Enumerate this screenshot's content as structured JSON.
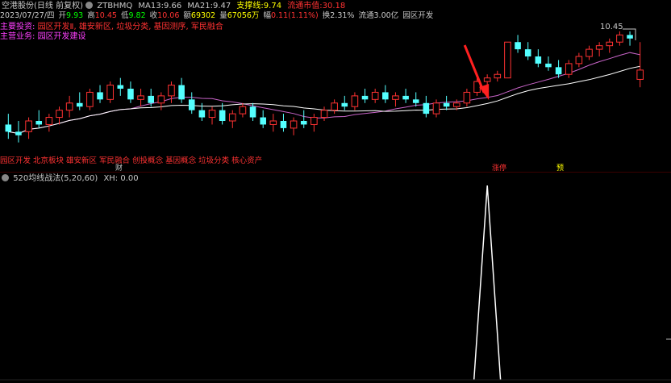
{
  "header": {
    "stock_title": "空港股份(日线 前复权)",
    "gear_icon": "gear-icon",
    "indicator_name": "ZTBHMQ",
    "ma13_label": "MA13:",
    "ma13_value": "9.66",
    "ma21_label": "MA21:",
    "ma21_value": "9.47",
    "support_label": "支撑线:",
    "support_value": "9.74",
    "float_cap_label": "流通市值:",
    "float_cap_value": "30.18"
  },
  "quote": {
    "date": "2023/07/27/四",
    "open_label": "开",
    "open": "9.93",
    "high_label": "高",
    "high": "10.45",
    "low_label": "低",
    "low": "9.82",
    "close_label": "收",
    "close": "10.06",
    "volume_label": "量",
    "volume": "67056万",
    "amount_label": "额",
    "amount": "69302",
    "change_label": "幅",
    "change": "0.11(1.11%)",
    "turnover_label": "换",
    "turnover": "2.31%",
    "float_label": "流通",
    "float": "3.00亿",
    "concept": "园区开发"
  },
  "business": {
    "main_label": "主要投资:",
    "main_text": "园区开发Ⅱ, 雄安新区, 垃圾分类, 基因测序, 军民融合",
    "operate_label": "主营业务:",
    "operate_text": "园区开发建设"
  },
  "concepts_bar": {
    "text": "园区开发 北京板块 雄安新区 军民融合 创投概念 基因概念 垃圾分类 核心资产"
  },
  "chart_labels": {
    "price_high_label": "10.45",
    "date_marker": "财",
    "limit_up_tag": "涨停",
    "forecast_tag": "预"
  },
  "indicator": {
    "title": "520均线战法(5,20,60)",
    "xh_label": "XH:",
    "xh_value": "0.00"
  },
  "colors": {
    "up": "#ff3232",
    "down": "#54ffff",
    "ma_white": "#ffffff",
    "ma_purple": "#c864c8",
    "annotation": "#ff2020",
    "indicator_line": "#ffffff",
    "label_yellow": "#ffff00",
    "label_purple": "#ff40ff"
  },
  "chart_data": {
    "type": "candlestick",
    "title": "空港股份(日线 前复权)",
    "x_range": [
      "",
      "2023/07/27"
    ],
    "y_axis": {
      "top_label": "10.45"
    },
    "candles": [
      {
        "o": 9.3,
        "h": 9.45,
        "l": 9.1,
        "c": 9.2
      },
      {
        "o": 9.2,
        "h": 9.35,
        "l": 9.05,
        "c": 9.15
      },
      {
        "o": 9.2,
        "h": 9.4,
        "l": 9.1,
        "c": 9.35
      },
      {
        "o": 9.35,
        "h": 9.5,
        "l": 9.25,
        "c": 9.3
      },
      {
        "o": 9.3,
        "h": 9.45,
        "l": 9.2,
        "c": 9.4
      },
      {
        "o": 9.4,
        "h": 9.55,
        "l": 9.3,
        "c": 9.5
      },
      {
        "o": 9.5,
        "h": 9.7,
        "l": 9.4,
        "c": 9.6
      },
      {
        "o": 9.6,
        "h": 9.75,
        "l": 9.5,
        "c": 9.55
      },
      {
        "o": 9.55,
        "h": 9.8,
        "l": 9.5,
        "c": 9.75
      },
      {
        "o": 9.75,
        "h": 9.85,
        "l": 9.6,
        "c": 9.65
      },
      {
        "o": 9.65,
        "h": 9.9,
        "l": 9.6,
        "c": 9.85
      },
      {
        "o": 9.85,
        "h": 9.95,
        "l": 9.7,
        "c": 9.8
      },
      {
        "o": 9.8,
        "h": 9.9,
        "l": 9.6,
        "c": 9.65
      },
      {
        "o": 9.65,
        "h": 9.8,
        "l": 9.55,
        "c": 9.7
      },
      {
        "o": 9.7,
        "h": 9.8,
        "l": 9.55,
        "c": 9.6
      },
      {
        "o": 9.6,
        "h": 9.75,
        "l": 9.5,
        "c": 9.7
      },
      {
        "o": 9.7,
        "h": 9.9,
        "l": 9.6,
        "c": 9.85
      },
      {
        "o": 9.85,
        "h": 9.95,
        "l": 9.6,
        "c": 9.65
      },
      {
        "o": 9.65,
        "h": 9.75,
        "l": 9.45,
        "c": 9.5
      },
      {
        "o": 9.5,
        "h": 9.6,
        "l": 9.35,
        "c": 9.4
      },
      {
        "o": 9.4,
        "h": 9.55,
        "l": 9.3,
        "c": 9.5
      },
      {
        "o": 9.5,
        "h": 9.6,
        "l": 9.3,
        "c": 9.35
      },
      {
        "o": 9.35,
        "h": 9.5,
        "l": 9.25,
        "c": 9.45
      },
      {
        "o": 9.45,
        "h": 9.6,
        "l": 9.4,
        "c": 9.55
      },
      {
        "o": 9.55,
        "h": 9.6,
        "l": 9.35,
        "c": 9.4
      },
      {
        "o": 9.4,
        "h": 9.5,
        "l": 9.25,
        "c": 9.3
      },
      {
        "o": 9.3,
        "h": 9.45,
        "l": 9.2,
        "c": 9.35
      },
      {
        "o": 9.35,
        "h": 9.45,
        "l": 9.2,
        "c": 9.25
      },
      {
        "o": 9.25,
        "h": 9.4,
        "l": 9.15,
        "c": 9.35
      },
      {
        "o": 9.35,
        "h": 9.5,
        "l": 9.25,
        "c": 9.3
      },
      {
        "o": 9.3,
        "h": 9.45,
        "l": 9.2,
        "c": 9.4
      },
      {
        "o": 9.4,
        "h": 9.55,
        "l": 9.35,
        "c": 9.5
      },
      {
        "o": 9.5,
        "h": 9.65,
        "l": 9.45,
        "c": 9.6
      },
      {
        "o": 9.6,
        "h": 9.7,
        "l": 9.5,
        "c": 9.55
      },
      {
        "o": 9.55,
        "h": 9.75,
        "l": 9.5,
        "c": 9.7
      },
      {
        "o": 9.7,
        "h": 9.8,
        "l": 9.6,
        "c": 9.65
      },
      {
        "o": 9.65,
        "h": 9.8,
        "l": 9.6,
        "c": 9.75
      },
      {
        "o": 9.75,
        "h": 9.85,
        "l": 9.6,
        "c": 9.65
      },
      {
        "o": 9.65,
        "h": 9.75,
        "l": 9.55,
        "c": 9.7
      },
      {
        "o": 9.7,
        "h": 9.8,
        "l": 9.6,
        "c": 9.65
      },
      {
        "o": 9.65,
        "h": 9.75,
        "l": 9.55,
        "c": 9.6
      },
      {
        "o": 9.6,
        "h": 9.7,
        "l": 9.4,
        "c": 9.45
      },
      {
        "o": 9.45,
        "h": 9.65,
        "l": 9.4,
        "c": 9.6
      },
      {
        "o": 9.6,
        "h": 9.7,
        "l": 9.5,
        "c": 9.55
      },
      {
        "o": 9.55,
        "h": 9.65,
        "l": 9.5,
        "c": 9.6
      },
      {
        "o": 9.6,
        "h": 9.8,
        "l": 9.55,
        "c": 9.75
      },
      {
        "o": 9.75,
        "h": 9.95,
        "l": 9.7,
        "c": 9.9
      },
      {
        "o": 9.9,
        "h": 10.0,
        "l": 9.85,
        "c": 9.95
      },
      {
        "o": 9.95,
        "h": 10.05,
        "l": 9.9,
        "c": 10.0
      },
      {
        "o": 9.95,
        "h": 10.45,
        "l": 9.95,
        "c": 10.45
      },
      {
        "o": 10.45,
        "h": 10.55,
        "l": 10.3,
        "c": 10.35
      },
      {
        "o": 10.35,
        "h": 10.45,
        "l": 10.2,
        "c": 10.25
      },
      {
        "o": 10.25,
        "h": 10.35,
        "l": 10.1,
        "c": 10.15
      },
      {
        "o": 10.15,
        "h": 10.25,
        "l": 10.05,
        "c": 10.1
      },
      {
        "o": 10.1,
        "h": 10.2,
        "l": 9.95,
        "c": 10.0
      },
      {
        "o": 10.0,
        "h": 10.2,
        "l": 9.95,
        "c": 10.15
      },
      {
        "o": 10.15,
        "h": 10.3,
        "l": 10.1,
        "c": 10.25
      },
      {
        "o": 10.25,
        "h": 10.4,
        "l": 10.2,
        "c": 10.35
      },
      {
        "o": 10.35,
        "h": 10.45,
        "l": 10.25,
        "c": 10.4
      },
      {
        "o": 10.4,
        "h": 10.5,
        "l": 10.3,
        "c": 10.45
      },
      {
        "o": 10.45,
        "h": 10.6,
        "l": 10.4,
        "c": 10.55
      },
      {
        "o": 10.55,
        "h": 10.6,
        "l": 10.4,
        "c": 10.5
      },
      {
        "o": 9.93,
        "h": 10.45,
        "l": 9.82,
        "c": 10.06
      }
    ],
    "ma_series": [
      {
        "name": "MA13",
        "color": "#c864c8"
      },
      {
        "name": "MA21",
        "color": "#ffffff"
      }
    ],
    "indicator_series": {
      "name": "XH",
      "values_spike_index": 47,
      "spike_value": 1,
      "baseline": 0
    }
  }
}
